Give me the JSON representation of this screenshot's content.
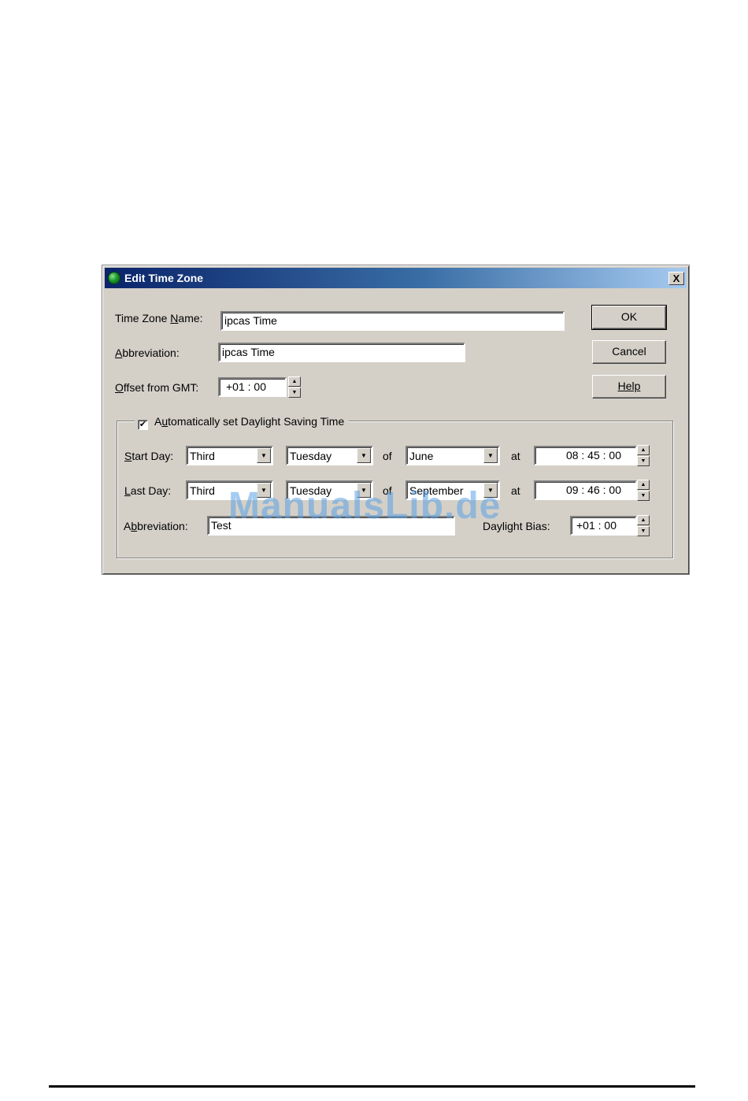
{
  "dialog": {
    "title": "Edit Time Zone",
    "close_label": "X",
    "time_zone_name": {
      "label_pre": "Time Zone ",
      "label_u": "N",
      "label_post": "ame:",
      "value": "ipcas Time"
    },
    "abbreviation": {
      "label_u": "A",
      "label_post": "bbreviation:",
      "value": "ipcas Time"
    },
    "offset": {
      "label_u": "O",
      "label_post": "ffset from GMT:",
      "value": "+01 : 00"
    },
    "buttons": {
      "ok": "OK",
      "cancel": "Cancel",
      "help": "Help"
    },
    "dst": {
      "checked": true,
      "check_mark": "✔",
      "label_pre": "A",
      "label_u": "u",
      "label_post": "tomatically set Daylight Saving Time",
      "start": {
        "label_pre": "S",
        "label_post": "tart Day:",
        "week": "Third",
        "weekday": "Tuesday",
        "of": "of",
        "month": "June",
        "at": "at",
        "time": "08 : 45 : 00"
      },
      "last": {
        "label_pre": "L",
        "label_post": "ast Day:",
        "week": "Third",
        "weekday": "Tuesday",
        "of": "of",
        "month": "September",
        "at": "at",
        "time": "09 : 46 : 00"
      },
      "abbreviation": {
        "label_pre": "A",
        "label_u": "b",
        "label_post": "breviation:",
        "value": "Test"
      },
      "bias": {
        "label": "Daylight Bias:",
        "value": "+01 : 00"
      }
    }
  },
  "watermark": "ManualsLib.de",
  "icons": {
    "spin_up": "▲",
    "spin_down": "▼",
    "dropdown": "▼"
  }
}
